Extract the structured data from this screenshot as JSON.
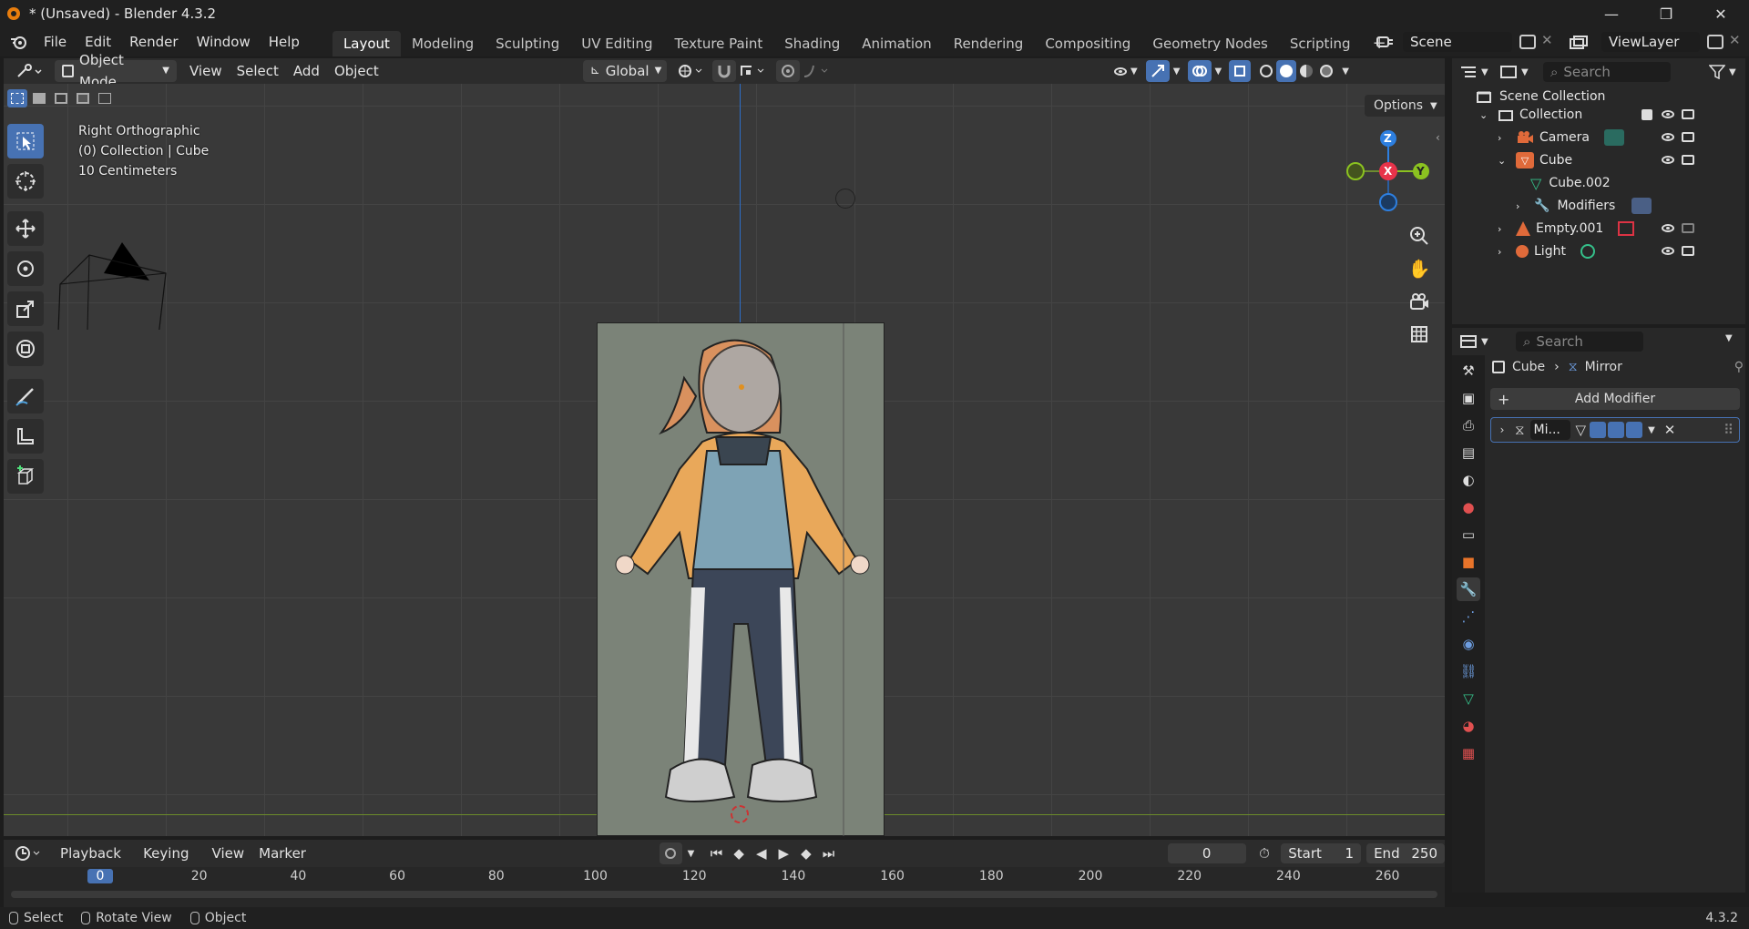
{
  "window": {
    "title": "* (Unsaved) - Blender 4.3.2",
    "min": "—",
    "max": "❐",
    "close": "✕"
  },
  "menu": [
    "File",
    "Edit",
    "Render",
    "Window",
    "Help"
  ],
  "workspaces": [
    "Layout",
    "Modeling",
    "Sculpting",
    "UV Editing",
    "Texture Paint",
    "Shading",
    "Animation",
    "Rendering",
    "Compositing",
    "Geometry Nodes",
    "Scripting"
  ],
  "workspace_add": "+",
  "scene": "Scene",
  "view_layer": "ViewLayer",
  "viewport_header": {
    "mode": "Object Mode",
    "menus": [
      "View",
      "Select",
      "Add",
      "Object"
    ],
    "orientation": "Global",
    "options": "Options"
  },
  "viewport_overlay": {
    "view": "Right Orthographic",
    "collection": "(0) Collection | Cube",
    "scale": "10 Centimeters"
  },
  "gizmo": {
    "z": "Z",
    "x": "X",
    "y": "Y"
  },
  "outliner": {
    "search_placeholder": "Search",
    "root": "Scene Collection",
    "items": [
      {
        "label": "Collection"
      },
      {
        "label": "Camera"
      },
      {
        "label": "Cube"
      },
      {
        "label": "Cube.002"
      },
      {
        "label": "Modifiers"
      },
      {
        "label": "Empty.001"
      },
      {
        "label": "Light"
      }
    ]
  },
  "properties": {
    "search_placeholder": "Search",
    "breadcrumb_object": "Cube",
    "breadcrumb_modifier": "Mirror",
    "add_modifier": "Add Modifier",
    "modifier_name": "Mi..."
  },
  "timeline": {
    "menus": [
      "Playback",
      "Keying",
      "View",
      "Marker"
    ],
    "current_frame": "0",
    "start_label": "Start",
    "start": "1",
    "end_label": "End",
    "end": "250",
    "ticks": [
      "0",
      "20",
      "40",
      "60",
      "80",
      "100",
      "120",
      "140",
      "160",
      "180",
      "200",
      "220",
      "240",
      "260"
    ]
  },
  "statusbar": {
    "select": "Select",
    "rotate": "Rotate View",
    "object": "Object",
    "version": "4.3.2"
  },
  "colors": {
    "accent": "#4772b3",
    "x_axis": "#e8334a",
    "y_axis": "#8bc220",
    "z_axis": "#2d7fe0"
  }
}
